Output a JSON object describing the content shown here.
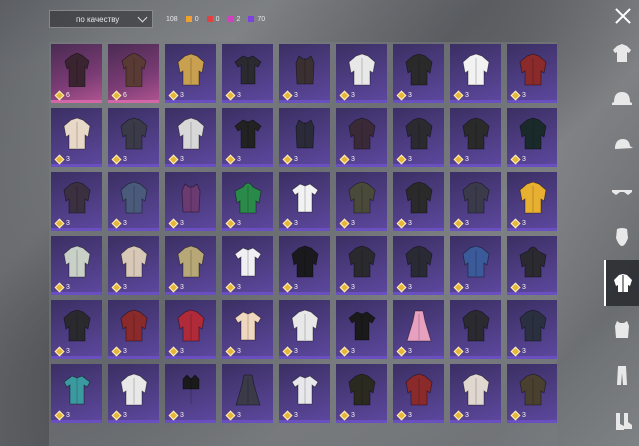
{
  "sort": {
    "label": "по качеству"
  },
  "counts": {
    "total": "108",
    "items": [
      {
        "color": "#f0a030",
        "value": "0"
      },
      {
        "color": "#e04040",
        "value": "0"
      },
      {
        "color": "#d040c0",
        "value": "2"
      },
      {
        "color": "#8040e0",
        "value": "70"
      }
    ]
  },
  "colors": {
    "legendary": "#b25590",
    "epic": "#5d48a0",
    "badge": "#e8b53b"
  },
  "items": [
    {
      "qty": "6",
      "rarity": "legendary",
      "color": "#3a2430",
      "type": "coat"
    },
    {
      "qty": "6",
      "rarity": "legendary",
      "color": "#5a3a34",
      "type": "coat"
    },
    {
      "qty": "3",
      "color": "#c9a050",
      "type": "jacket"
    },
    {
      "qty": "3",
      "color": "#2a2a30",
      "type": "shirt"
    },
    {
      "qty": "3",
      "color": "#3a3032",
      "type": "vest"
    },
    {
      "qty": "3",
      "color": "#e8e8e8",
      "type": "jacket"
    },
    {
      "qty": "3",
      "color": "#2a2a2a",
      "type": "jacket"
    },
    {
      "qty": "3",
      "color": "#f2f2f2",
      "type": "jacket"
    },
    {
      "qty": "3",
      "color": "#8a2a2a",
      "type": "jacket"
    },
    {
      "qty": "3",
      "color": "#e8d8c8",
      "type": "jacket"
    },
    {
      "qty": "3",
      "color": "#3a3a48",
      "type": "jacket"
    },
    {
      "qty": "3",
      "color": "#d8d8d8",
      "type": "jacket"
    },
    {
      "qty": "3",
      "color": "#222222",
      "type": "shirt"
    },
    {
      "qty": "3",
      "color": "#2a2a38",
      "type": "vest"
    },
    {
      "qty": "3",
      "color": "#3a2a38",
      "type": "jacket"
    },
    {
      "qty": "3",
      "color": "#2a2a30",
      "type": "jacket"
    },
    {
      "qty": "3",
      "color": "#2a2a2a",
      "type": "jacket"
    },
    {
      "qty": "3",
      "color": "#1a2a2a",
      "type": "jacket"
    },
    {
      "qty": "3",
      "color": "#3a3040",
      "type": "jacket"
    },
    {
      "qty": "3",
      "color": "#4a5a7a",
      "type": "jacket"
    },
    {
      "qty": "3",
      "color": "#6a3a70",
      "type": "vest"
    },
    {
      "qty": "3",
      "color": "#2a8a4a",
      "type": "hoodie"
    },
    {
      "qty": "3",
      "color": "#f2f2f2",
      "type": "shirt"
    },
    {
      "qty": "3",
      "color": "#4a4a3a",
      "type": "jacket"
    },
    {
      "qty": "3",
      "color": "#2a2a2a",
      "type": "jacket"
    },
    {
      "qty": "3",
      "color": "#3a3a4a",
      "type": "jacket"
    },
    {
      "qty": "3",
      "color": "#e8b030",
      "type": "jacket"
    },
    {
      "qty": "3",
      "color": "#c8d0c8",
      "type": "jacket"
    },
    {
      "qty": "3",
      "color": "#d8c8b8",
      "type": "jacket"
    },
    {
      "qty": "3",
      "color": "#b8a878",
      "type": "jacket"
    },
    {
      "qty": "3",
      "color": "#f0f0f4",
      "type": "shirt"
    },
    {
      "qty": "3",
      "color": "#1a1a1e",
      "type": "jacket"
    },
    {
      "qty": "3",
      "color": "#2a2a2e",
      "type": "jacket"
    },
    {
      "qty": "3",
      "color": "#2a2a34",
      "type": "jacket"
    },
    {
      "qty": "3",
      "color": "#3a5a9a",
      "type": "jacket"
    },
    {
      "qty": "3",
      "color": "#2a2a30",
      "type": "hoodie"
    },
    {
      "qty": "3",
      "color": "#2a2a2e",
      "type": "jacket"
    },
    {
      "qty": "3",
      "color": "#8a2a2a",
      "type": "jacket"
    },
    {
      "qty": "3",
      "color": "#b02a3a",
      "type": "jacket"
    },
    {
      "qty": "3",
      "color": "#f0d8c0",
      "type": "shirt"
    },
    {
      "qty": "3",
      "color": "#e8e8e8",
      "type": "jacket"
    },
    {
      "qty": "3",
      "color": "#1a1a1a",
      "type": "shirt"
    },
    {
      "qty": "3",
      "color": "#e8a0c0",
      "type": "dress"
    },
    {
      "qty": "3",
      "color": "#2a2a30",
      "type": "jacket"
    },
    {
      "qty": "3",
      "color": "#2a3040",
      "type": "jacket"
    },
    {
      "qty": "3",
      "color": "#3a9aa0",
      "type": "shirt"
    },
    {
      "qty": "3",
      "color": "#e8e8e8",
      "type": "jacket"
    },
    {
      "qty": "3",
      "color": "#1a1a1a",
      "type": "top"
    },
    {
      "qty": "3",
      "color": "#3a3a48",
      "type": "dress"
    },
    {
      "qty": "3",
      "color": "#e8e8ec",
      "type": "shirt"
    },
    {
      "qty": "3",
      "color": "#2a2a20",
      "type": "jacket"
    },
    {
      "qty": "3",
      "color": "#8a2a2a",
      "type": "jacket"
    },
    {
      "qty": "3",
      "color": "#e0d8d0",
      "type": "jacket"
    },
    {
      "qty": "3",
      "color": "#4a4030",
      "type": "jacket"
    }
  ],
  "sidebar": [
    {
      "icon": "outfit-icon"
    },
    {
      "icon": "helmet-icon"
    },
    {
      "icon": "cap-icon"
    },
    {
      "icon": "glasses-icon"
    },
    {
      "icon": "mask-icon"
    },
    {
      "icon": "jacket-icon",
      "active": true
    },
    {
      "icon": "vest-icon"
    },
    {
      "icon": "pants-icon"
    },
    {
      "icon": "shoes-icon"
    }
  ]
}
